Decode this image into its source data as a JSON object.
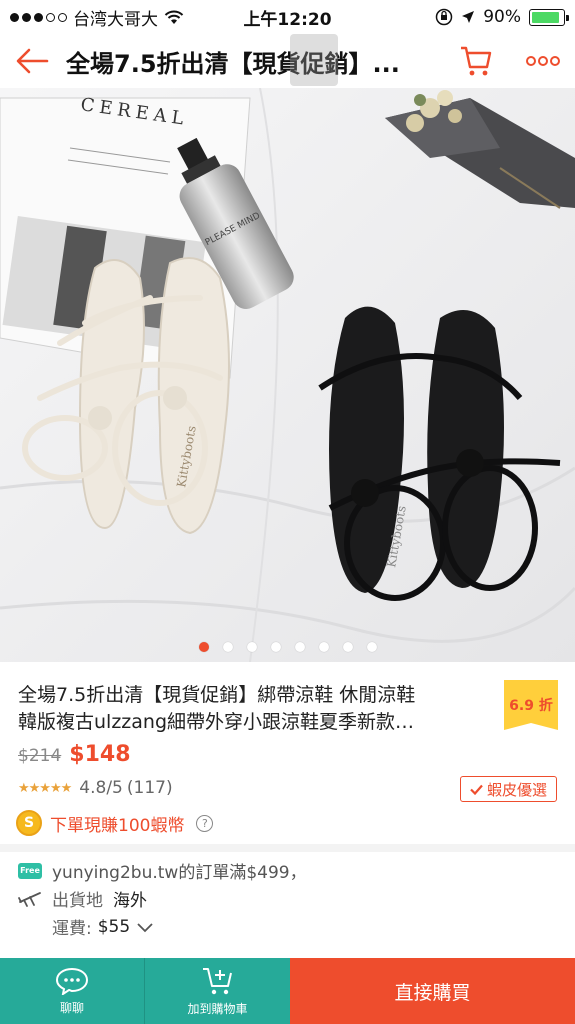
{
  "status_bar": {
    "carrier": "台湾大哥大",
    "time": "上午12:20",
    "battery": "90%",
    "battery_level": 0.9
  },
  "nav": {
    "title": "全場7.5折出清【現貨促銷】..."
  },
  "gallery": {
    "image_count": 8,
    "active_index": 0,
    "image_labels": {
      "book_title": "CEREAL",
      "bottle_text": "PLEASE MIND",
      "brand_left": "Kittyboots",
      "brand_right": "Kittyboots"
    }
  },
  "product": {
    "title_line1": "全場7.5折出清【現貨促銷】綁帶涼鞋 休閒涼鞋",
    "title_line2": "韓版複古ulzzang細帶外穿小跟涼鞋夏季新款…",
    "discount": "6.9 折",
    "old_price": "$214",
    "price": "$148",
    "stars": "★★★★★",
    "rating": "4.8/5",
    "review_count": "(117)",
    "preferred_label": "蝦皮優選",
    "coin_symbol": "S",
    "coin_text": "下單現賺100蝦幣",
    "help_symbol": "?"
  },
  "shipping": {
    "free_badge": "Free",
    "promo_text": "yunying2bu.tw的訂單滿$499，",
    "from_label": "出貨地",
    "from_value": "海外",
    "fee_label": "運費:",
    "fee_value": "$55"
  },
  "bottom_bar": {
    "chat_label": "聊聊",
    "add_cart_label": "加到購物車",
    "buy_label": "直接購買"
  },
  "colors": {
    "accent": "#ee4d2d",
    "teal": "#26aa99",
    "badge_yellow": "#ffcf3b",
    "star": "#e9a23b"
  }
}
